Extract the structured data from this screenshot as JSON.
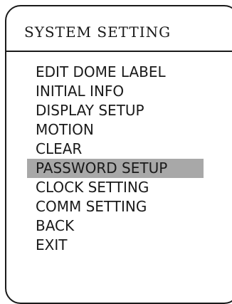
{
  "menu": {
    "title": "SYSTEM SETTING",
    "selected_index": 5,
    "items": [
      {
        "label": "EDIT DOME LABEL"
      },
      {
        "label": "INITIAL INFO"
      },
      {
        "label": "DISPLAY SETUP"
      },
      {
        "label": "MOTION"
      },
      {
        "label": "CLEAR"
      },
      {
        "label": "PASSWORD SETUP"
      },
      {
        "label": "CLOCK SETTING"
      },
      {
        "label": "COMM SETTING"
      },
      {
        "label": "BACK"
      },
      {
        "label": "EXIT"
      }
    ]
  }
}
